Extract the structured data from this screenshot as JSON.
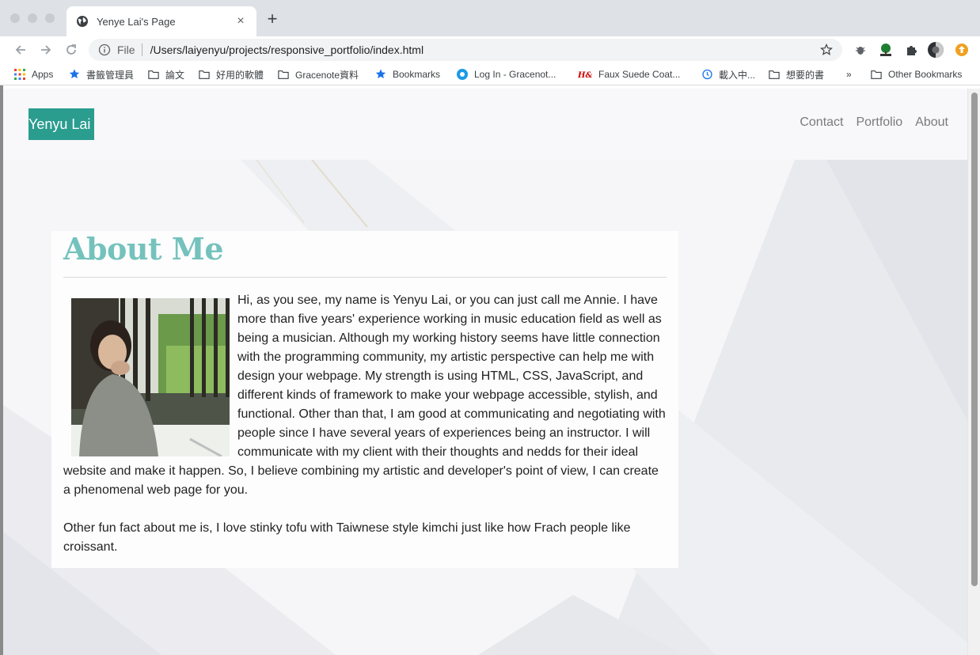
{
  "browser": {
    "tab_title": "Yenye Lai's Page",
    "scheme": "File",
    "url": "/Users/laiyenyu/projects/responsive_portfolio/index.html",
    "bookmarks": [
      "Apps",
      "書籤管理員",
      "論文",
      "好用的軟體",
      "Gracenote資料",
      "Bookmarks",
      "Log In - Gracenot...",
      "Faux Suede Coat...",
      "載入中...",
      "想要的書",
      "»",
      "Other Bookmarks"
    ]
  },
  "site": {
    "brand": "Yenyu Lai",
    "nav": [
      "Contact",
      "Portfolio",
      "About"
    ],
    "about": {
      "heading": "About Me",
      "paragraph1": "Hi, as you see, my name is Yenyu Lai, or you can just call me Annie. I have more than five years' experience working in music education field as well as being a musician. Although my working history seems have little connection with the programming community, my artistic perspective can help me with design your webpage. My strength is using HTML, CSS, JavaScript, and different kinds of framework to make your webpage accessible, stylish, and functional. Other than that, I am good at communicating and negotiating with people since I have several years of experiences being an instructor. I will communicate with my client with their thoughts and nedds for their ideal website and make it happen. So, I believe combining my artistic and developer's point of view, I can create a phenomenal web page for you.",
      "paragraph2": "Other fun fact about me is, I love stinky tofu with Taiwnese style kimchi just like how Frach people like croissant."
    }
  },
  "colors": {
    "brand_bg": "#2a9d8f",
    "heading": "#75c2bd",
    "nav_text": "#7a7a7a"
  }
}
